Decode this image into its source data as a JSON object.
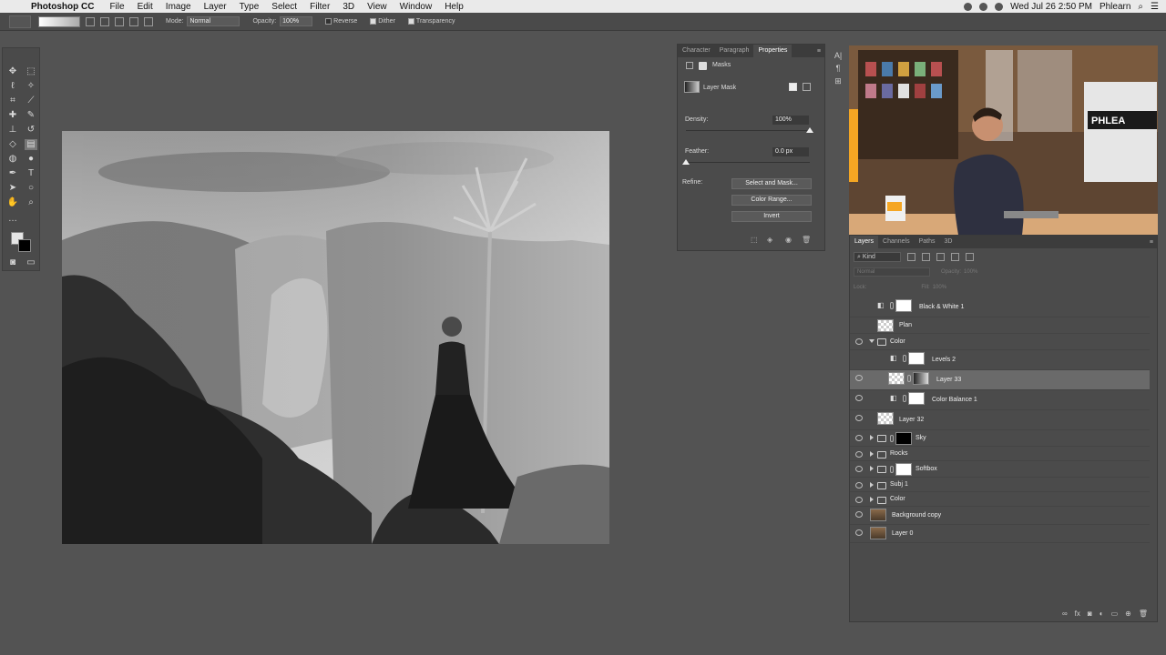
{
  "menubar": {
    "app_name": "Photoshop CC",
    "items": [
      "File",
      "Edit",
      "Image",
      "Layer",
      "Type",
      "Select",
      "Filter",
      "3D",
      "View",
      "Window",
      "Help"
    ],
    "datetime": "Wed Jul 26  2:50 PM",
    "user": "Phlearn"
  },
  "options": {
    "mode_label": "Mode:",
    "mode_value": "Normal",
    "opacity_label": "Opacity:",
    "opacity_value": "100%",
    "reverse": "Reverse",
    "dither": "Dither",
    "transparency": "Transparency"
  },
  "properties": {
    "tabs": [
      "Character",
      "Paragraph",
      "Properties"
    ],
    "active_tab": "Properties",
    "section": "Masks",
    "mask_type": "Layer Mask",
    "density_label": "Density:",
    "density_value": "100%",
    "density_fraction": 1.0,
    "feather_label": "Feather:",
    "feather_value": "0.0 px",
    "feather_fraction": 0.0,
    "refine_label": "Refine:",
    "buttons": [
      "Select and Mask...",
      "Color Range...",
      "Invert"
    ]
  },
  "layers_panel": {
    "tabs": [
      "Layers",
      "Channels",
      "Paths",
      "3D"
    ],
    "active_tab": "Layers",
    "kind_label": "Kind",
    "mode_value": "Normal",
    "opacity_label": "Opacity:",
    "opacity_value": "100%",
    "lock_label": "Lock:",
    "fill_label": "Fill:",
    "fill_value": "100%",
    "layers": [
      {
        "name": "Black & White 1",
        "visible": false,
        "type": "adjustment"
      },
      {
        "name": "Plan",
        "visible": false,
        "type": "pixel"
      },
      {
        "name": "Color",
        "visible": true,
        "type": "group-open"
      },
      {
        "name": "Levels 2",
        "visible": false,
        "type": "adjustment"
      },
      {
        "name": "Layer 33",
        "visible": true,
        "type": "masked",
        "selected": true
      },
      {
        "name": "Color Balance 1",
        "visible": true,
        "type": "adjustment"
      },
      {
        "name": "Layer 32",
        "visible": true,
        "type": "pixel"
      },
      {
        "name": "Sky",
        "visible": true,
        "type": "group-masked"
      },
      {
        "name": "Rocks",
        "visible": true,
        "type": "group"
      },
      {
        "name": "Softbox",
        "visible": true,
        "type": "group-masked-white"
      },
      {
        "name": "Subj 1",
        "visible": true,
        "type": "group"
      },
      {
        "name": "Color",
        "visible": true,
        "type": "group"
      },
      {
        "name": "Background copy",
        "visible": true,
        "type": "photo"
      },
      {
        "name": "Layer 0",
        "visible": true,
        "type": "photo"
      }
    ]
  },
  "video": {
    "sign_text": "PHLEA"
  }
}
